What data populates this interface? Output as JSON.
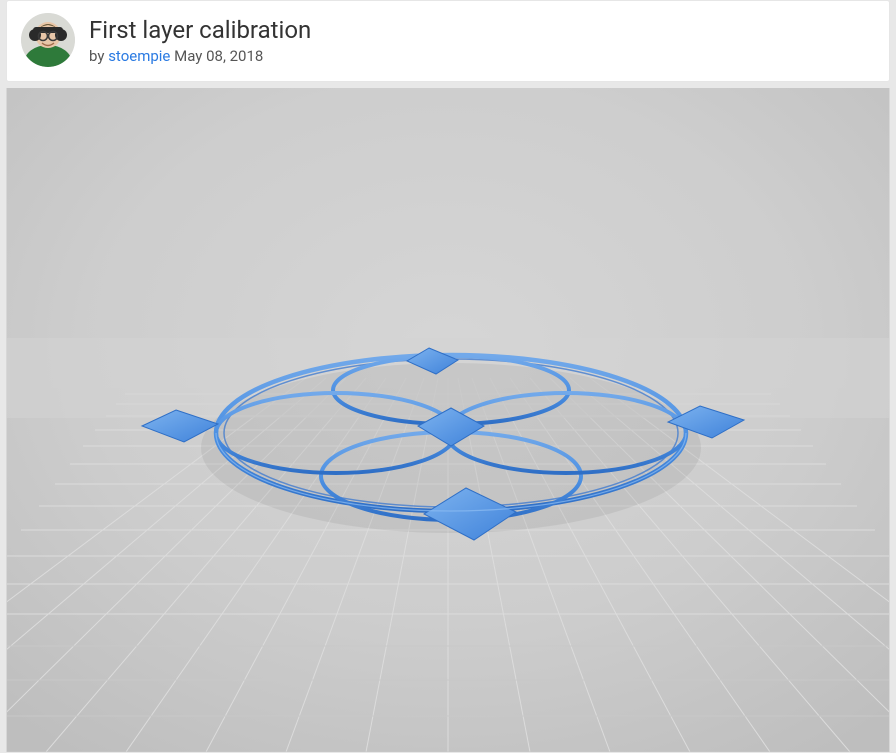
{
  "header": {
    "title": "First layer calibration",
    "by_label": "by",
    "author": "stoempie",
    "date": "May 08, 2018"
  },
  "viewer": {
    "model_name": "first-layer-calibration-preview",
    "accent_color": "#4b8fe2",
    "grid_color_light": "#d2d2d2",
    "grid_color_dark": "#b9b9b9"
  }
}
